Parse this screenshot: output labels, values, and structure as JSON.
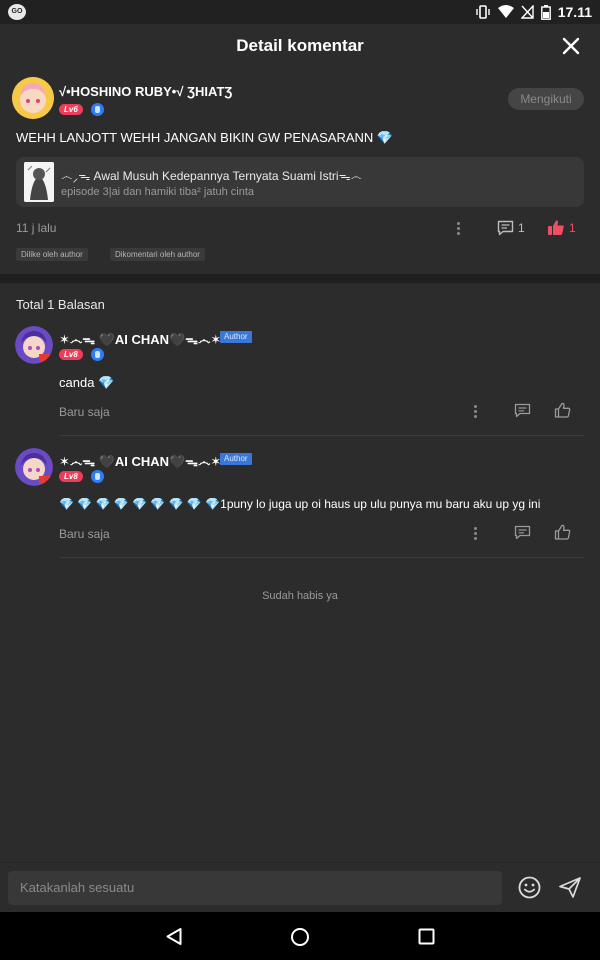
{
  "status_bar": {
    "app_icon": "GO",
    "time": "17.11"
  },
  "header": {
    "title": "Detail komentar"
  },
  "main_comment": {
    "username": "√•HOSHINO RUBY•√ ƷHIATƷ",
    "level": "Lv6",
    "follow_label": "Mengikuti",
    "text": "WEHH LANJOTT WEHH JANGAN BIKIN GW PENASARANN 💎",
    "reference": {
      "title": "෴⸝ᯓ Awal Musuh Kedepannya Ternyata Suami Istriᯓ෴",
      "subtitle": "episode 3|ai dan hamiki tiba² jatuh cinta"
    },
    "time": "11 j lalu",
    "reply_count": "1",
    "like_count": "1",
    "tags": [
      "Dilike oleh author",
      "Dikomentari oleh author"
    ]
  },
  "total_label": "Total 1 Balasan",
  "replies": [
    {
      "username": "✶෴ᯓ 🖤AI CHAN🖤ᯓ෴✶",
      "level": "Lv8",
      "author_label": "Author",
      "text": "canda 💎",
      "time": "Baru saja"
    },
    {
      "username": "✶෴ᯓ 🖤AI CHAN🖤ᯓ෴✶",
      "level": "Lv8",
      "author_label": "Author",
      "text": "💎 💎 💎 💎 💎 💎 💎 💎 💎1puny lo juga up oi haus up ulu punya mu baru aku up yg ini",
      "time": "Baru saja"
    }
  ],
  "end_label": "Sudah habis ya",
  "input": {
    "placeholder": "Katakanlah sesuatu"
  },
  "colors": {
    "background": "#2c2c2c",
    "like": "#ef4e66",
    "level_badge": "#ef3c5a",
    "author_badge": "#3978d8"
  },
  "icons": [
    "go-app-icon",
    "vibrate-icon",
    "wifi-icon",
    "no-sim-icon",
    "battery-icon",
    "close-icon",
    "more-icon",
    "comment-icon",
    "thumbs-up-icon",
    "emoji-icon",
    "send-icon",
    "back-icon",
    "home-icon",
    "recents-icon"
  ]
}
